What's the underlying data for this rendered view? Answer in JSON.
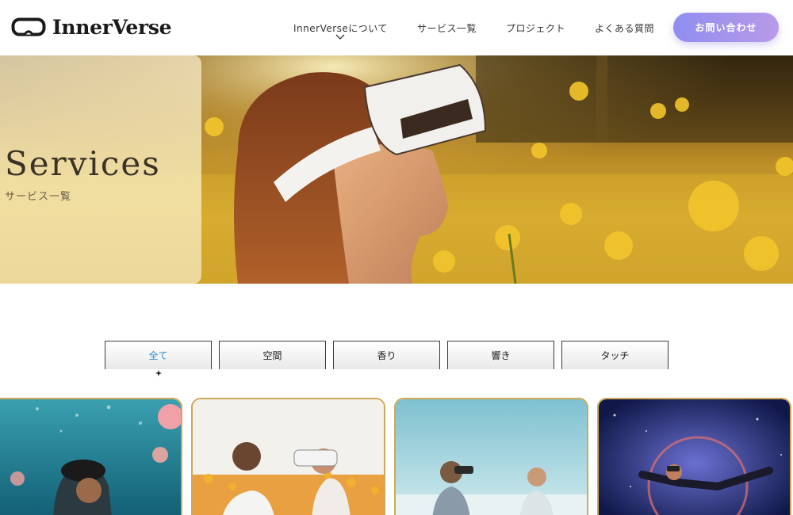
{
  "brand": {
    "name": "InnerVerse",
    "logo_icon": "vr-headset-icon"
  },
  "nav": {
    "items": [
      {
        "label": "InnerVerseについて",
        "has_dropdown": true
      },
      {
        "label": "サービス一覧"
      },
      {
        "label": "プロジェクト"
      },
      {
        "label": "よくある質問"
      }
    ],
    "contact_label": "お問い合わせ"
  },
  "hero": {
    "title": "Services",
    "subtitle": "サービス一覧"
  },
  "filters": {
    "tabs": [
      {
        "label": "全て",
        "active": true
      },
      {
        "label": "空間"
      },
      {
        "label": "香り"
      },
      {
        "label": "響き"
      },
      {
        "label": "タッチ"
      }
    ]
  },
  "cards": [
    {
      "theme": "underwater-jellyfish"
    },
    {
      "theme": "flower-field-couple"
    },
    {
      "theme": "beach-couple"
    },
    {
      "theme": "space-floating"
    }
  ],
  "colors": {
    "accent_gradient_start": "#8f8ef0",
    "accent_gradient_end": "#b89ae8",
    "active_tab": "#2a8fd4",
    "card_border": "#cfa955"
  }
}
